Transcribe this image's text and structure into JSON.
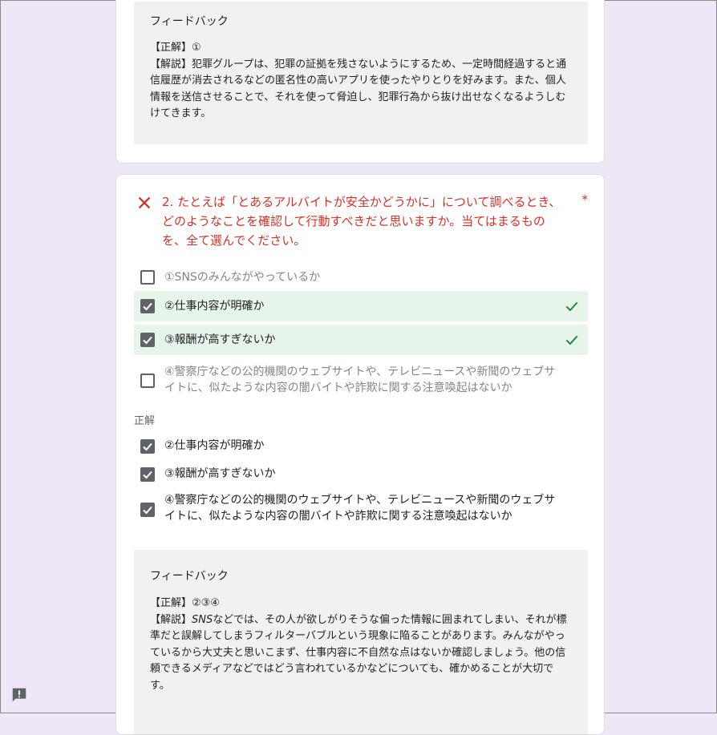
{
  "feedback1": {
    "title": "フィードバック",
    "answer": "【正解】①",
    "explanation": "【解説】犯罪グループは、犯罪の証拠を残さないようにするため、一定時間経過すると通信履歴が消去されるなどの匿名性の高いアプリを使ったやりとりを好みます。また、個人情報を送信させることで、それを使って脅迫し、犯罪行為から抜け出せなくなるようしむけてきます。"
  },
  "question2": {
    "title": "2. たとえば「とあるアルバイトが安全かどうかに」について調べるとき、どのようなことを確認して行動すべきだと思いますか。当てはまるものを、全て選んでください。",
    "required_mark": "*",
    "options": [
      {
        "label": "①SNSのみんながやっているか",
        "checked": false,
        "correct": false
      },
      {
        "label": "②仕事内容が明確か",
        "checked": true,
        "correct": true
      },
      {
        "label": "③報酬が高すぎないか",
        "checked": true,
        "correct": true
      },
      {
        "label": "④警察庁などの公的機関のウェブサイトや、テレビニュースや新聞のウェブサイトに、似たような内容の闇バイトや詐欺に関する注意喚起はないか",
        "checked": false,
        "correct": false
      }
    ],
    "correct_label": "正解",
    "correct_answers": [
      "②仕事内容が明確か",
      "③報酬が高すぎないか",
      "④警察庁などの公的機関のウェブサイトや、テレビニュースや新聞のウェブサイトに、似たような内容の闇バイトや詐欺に関する注意喚起はないか"
    ]
  },
  "feedback2": {
    "title": "フィードバック",
    "answer": "【正解】②③④",
    "explanation_prefix": "【解説】",
    "explanation_italic": "SNS",
    "explanation_rest": "などでは、その人が欲しがりそうな偏った情報に囲まれてしまい、それが標準だと誤解してしまうフィルターバブルという現象に陥ることがあります。みんながやっているから大丈夫と思いこまず、仕事内容に不自然な点はないか確認しましょう。他の信頼できるメディアなどではどう言われているかなどについても、確かめることが大切です。"
  },
  "colors": {
    "incorrect": "#d93025",
    "correct_bg": "#e6f4ea",
    "check_green": "#188038",
    "page_bg": "#ede7f6"
  }
}
